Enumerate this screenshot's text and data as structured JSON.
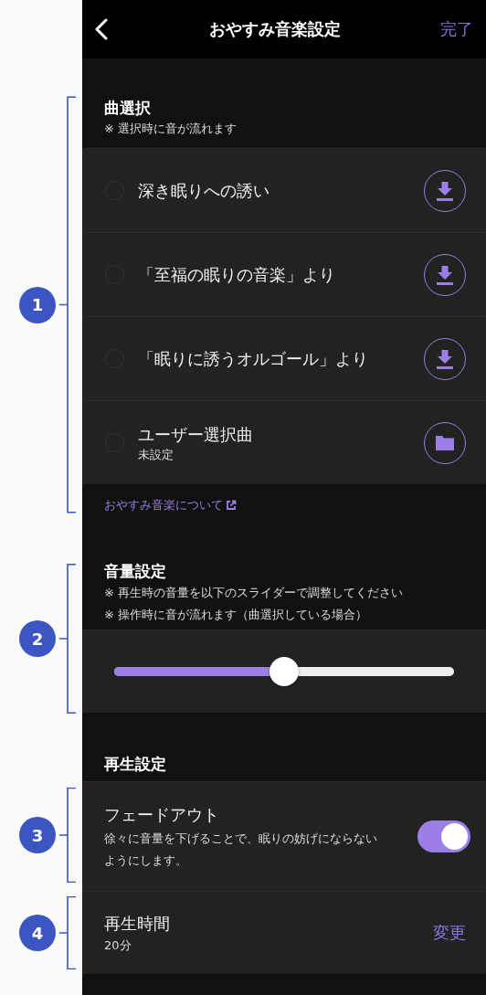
{
  "header": {
    "title": "おやすみ音楽設定",
    "done": "完了"
  },
  "song_section": {
    "title": "曲選択",
    "note": "※ 選択時に音が流れます",
    "songs": [
      {
        "title": "深き眠りへの誘い",
        "selected": false,
        "kind": "download"
      },
      {
        "title": "「至福の眠りの音楽」より",
        "selected": false,
        "kind": "download"
      },
      {
        "title": "「眠りに誘うオルゴール」より",
        "selected": false,
        "kind": "download"
      },
      {
        "title": "ユーザー選択曲",
        "subtitle": "未設定",
        "selected": false,
        "kind": "folder"
      }
    ],
    "link": "おやすみ音楽について"
  },
  "volume_section": {
    "title": "音量設定",
    "notes": [
      "※ 再生時の音量を以下のスライダーで調整してください",
      "※ 操作時に音が流れます（曲選択している場合）"
    ],
    "level": 0.5
  },
  "playback_section": {
    "title": "再生設定",
    "fadeout": {
      "label": "フェードアウト",
      "description": "徐々に音量を下げることで、眠りの妨げにならないようにします。",
      "on": true
    },
    "duration": {
      "label": "再生時間",
      "value": "20分",
      "action": "変更"
    }
  },
  "annotations": [
    {
      "number": "1"
    },
    {
      "number": "2"
    },
    {
      "number": "3"
    },
    {
      "number": "4"
    }
  ]
}
